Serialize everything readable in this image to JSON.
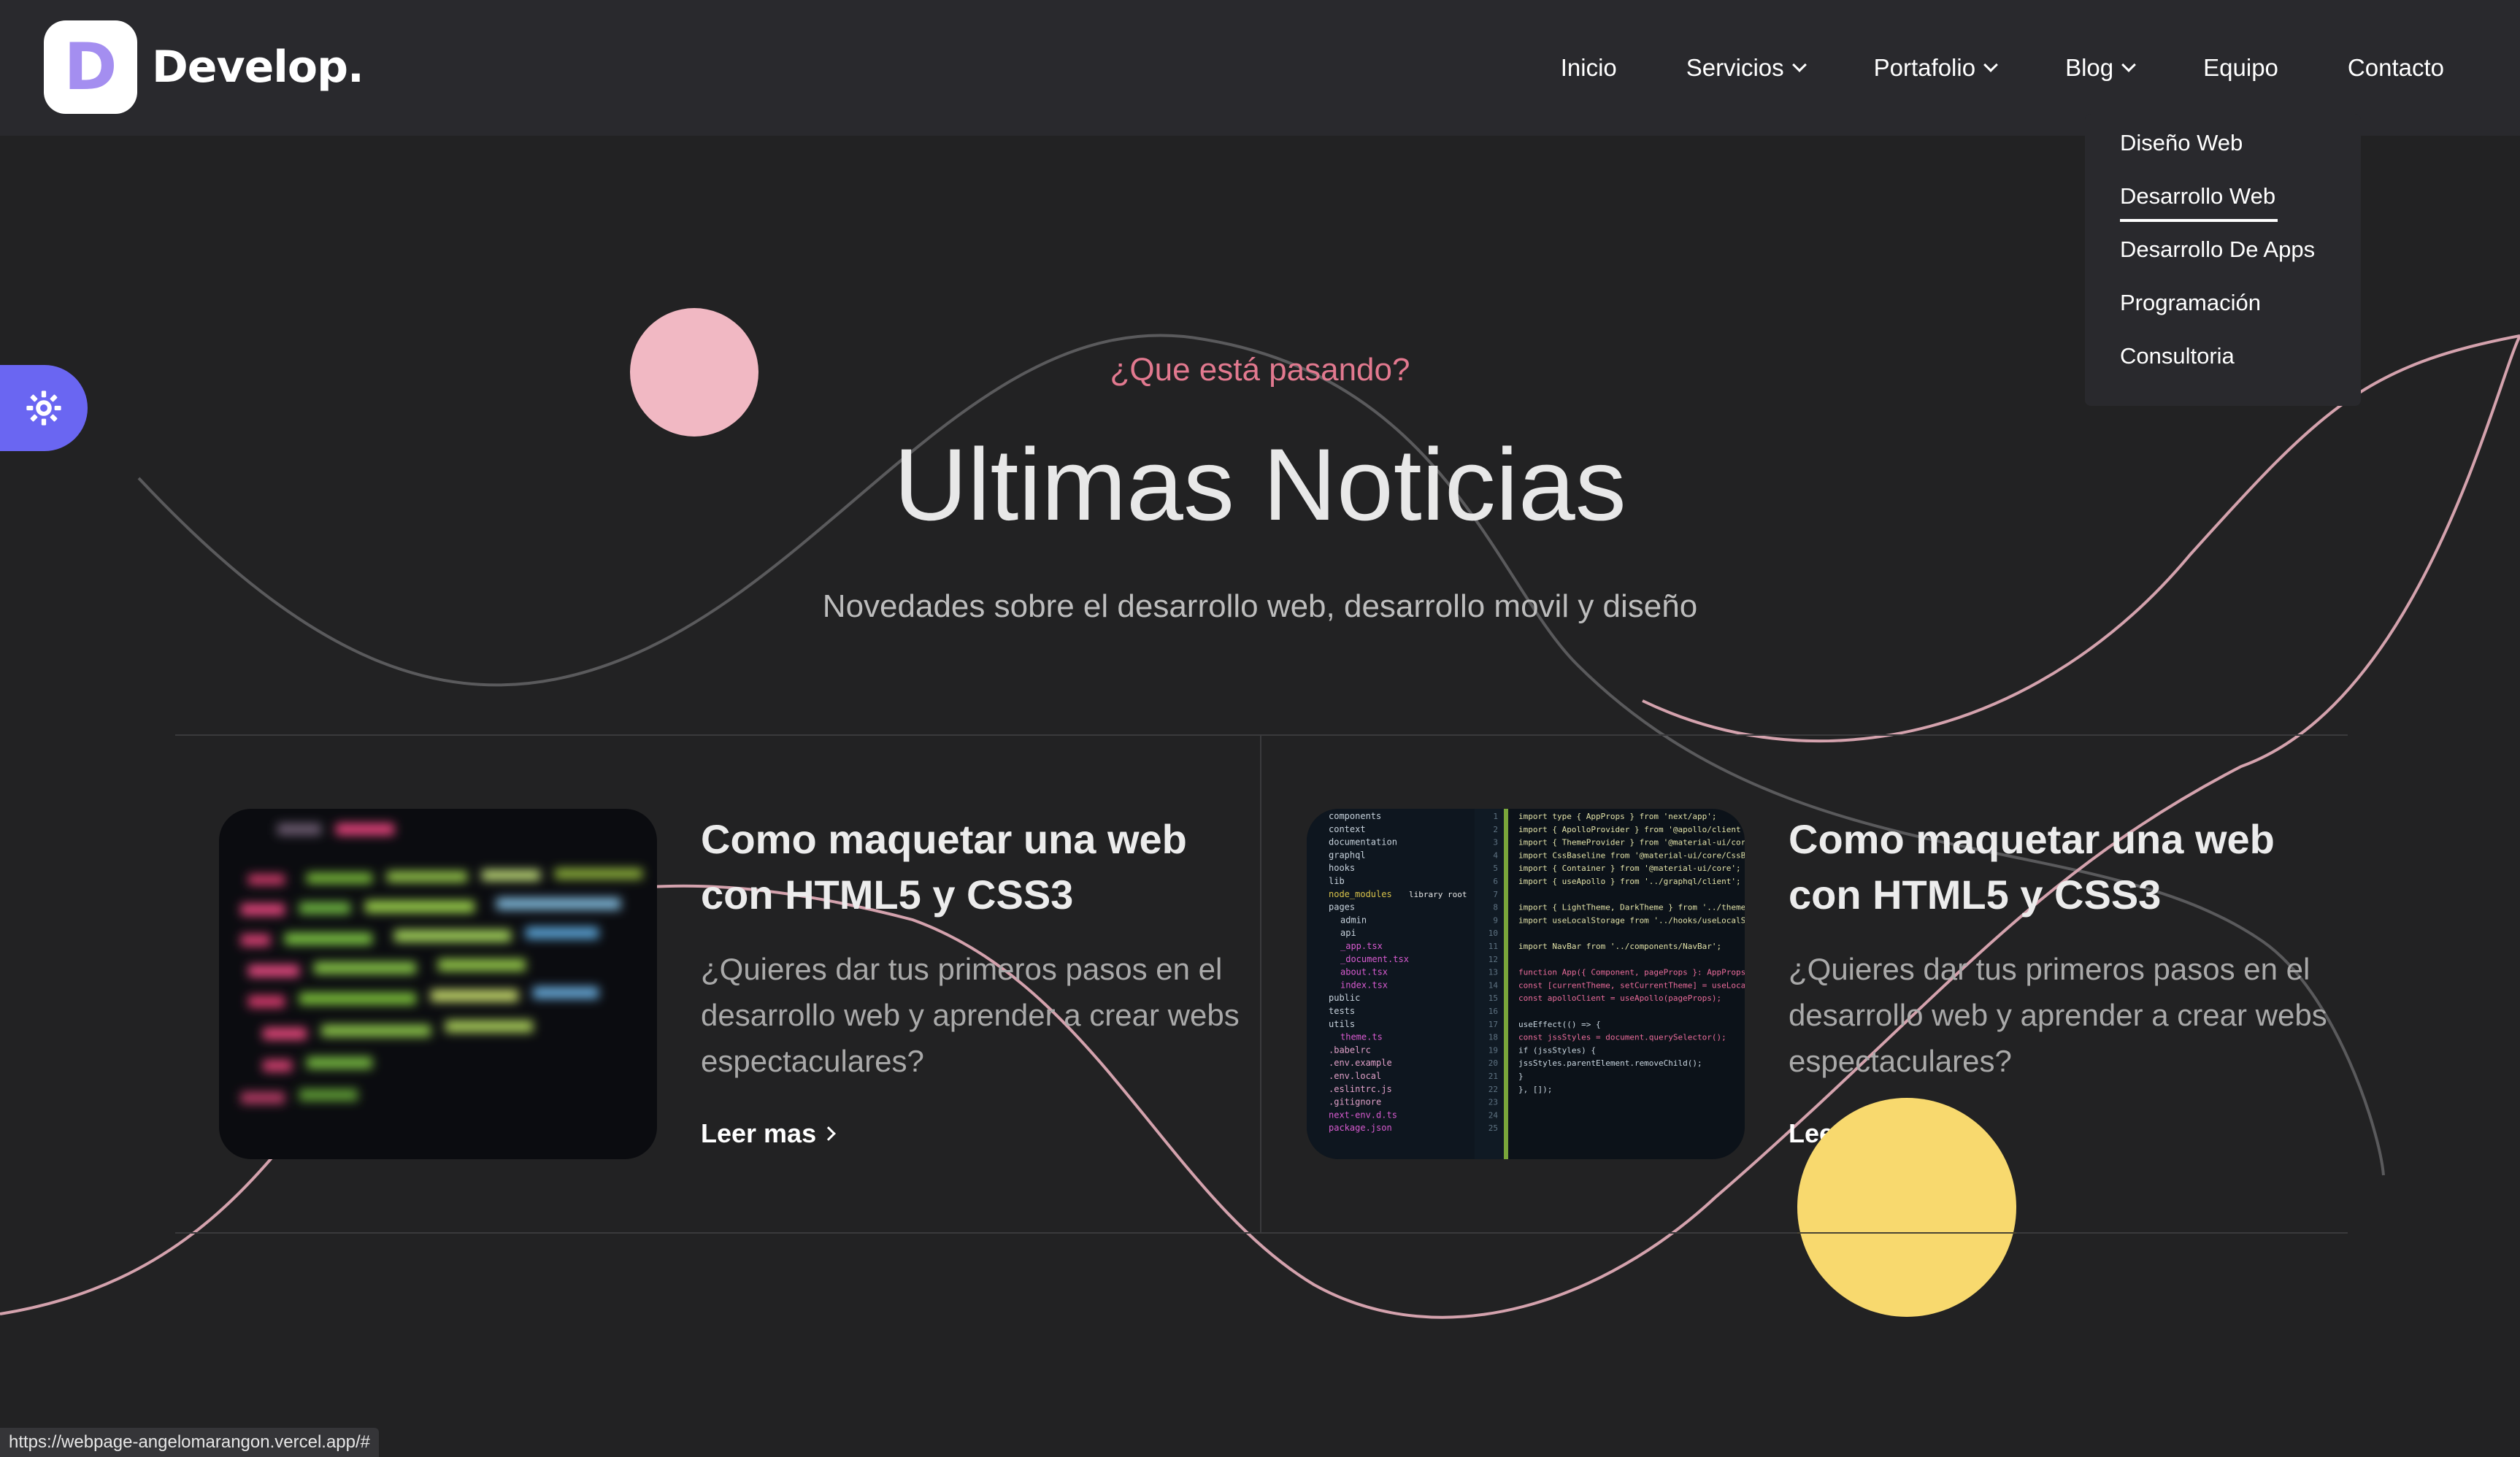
{
  "brand": {
    "letter": "D",
    "name": "Develop."
  },
  "nav": {
    "items": [
      {
        "label": "Inicio",
        "has_dropdown": false
      },
      {
        "label": "Servicios",
        "has_dropdown": true
      },
      {
        "label": "Portafolio",
        "has_dropdown": true
      },
      {
        "label": "Blog",
        "has_dropdown": true
      },
      {
        "label": "Equipo",
        "has_dropdown": false
      },
      {
        "label": "Contacto",
        "has_dropdown": false
      }
    ]
  },
  "dropdown": {
    "items": [
      {
        "label": "Diseño Web"
      },
      {
        "label": "Desarrollo Web",
        "active": true
      },
      {
        "label": "Desarrollo De Apps"
      },
      {
        "label": "Programación"
      },
      {
        "label": "Consultoria"
      }
    ]
  },
  "settings": {
    "icon": "gear-icon"
  },
  "hero": {
    "eyebrow": "¿Que está pasando?",
    "title": "Ultimas Noticias",
    "subtitle": "Novedades sobre el desarrollo web, desarrollo movil y diseño"
  },
  "posts": [
    {
      "title": "Como maquetar una web con HTML5 y CSS3",
      "excerpt": "¿Quieres dar tus primeros pasos en el desarrollo web y aprender a crear webs espectaculares?",
      "link_label": "Leer mas"
    },
    {
      "title": "Como maquetar una web con HTML5 y CSS3",
      "excerpt": "¿Quieres dar tus primeros pasos en el desarrollo web y aprender a crear webs espectaculares?",
      "link_label": "Leer mas"
    }
  ],
  "code_image": {
    "tree": [
      "components",
      "context",
      "documentation",
      "graphql",
      "hooks",
      "lib",
      "node_modules",
      "pages",
      "admin",
      "api",
      "_app.tsx",
      "_document.tsx",
      "about.tsx",
      "index.tsx",
      "public",
      "tests",
      "utils",
      "theme.ts",
      ".babelrc",
      ".env.example",
      ".env.local",
      ".eslintrc.js",
      ".gitignore",
      "next-env.d.ts",
      "package.json"
    ],
    "tree_badge": "library root",
    "code": [
      "import type { AppProps } from 'next/app';",
      "import { ApolloProvider } from '@apollo/client';",
      "import { ThemeProvider } from '@material-ui/core';",
      "import CssBaseline from '@material-ui/core/CssBaseline';",
      "import { Container } from '@material-ui/core';",
      "import { useApollo } from '../graphql/client';",
      "",
      "import { LightTheme, DarkTheme } from '../theme';",
      "import useLocalStorage from '../hooks/useLocalStorage';",
      "",
      "import NavBar from '../components/NavBar';",
      "",
      "function App({ Component, pageProps }: AppProps) {",
      "  const [currentTheme, setCurrentTheme] = useLocalStorage();",
      "  const apolloClient = useApollo(pageProps);",
      "",
      "  useEffect(() => {",
      "    const jssStyles = document.querySelector();",
      "    if (jssStyles) {",
      "      jssStyles.parentElement.removeChild();",
      "    }",
      "  }, []);"
    ],
    "line_numbers": [
      "1",
      "2",
      "3",
      "4",
      "5",
      "6",
      "7",
      "8",
      "9",
      "10",
      "11",
      "12",
      "13",
      "14",
      "15",
      "16",
      "17",
      "18",
      "19",
      "20",
      "21",
      "22",
      "23",
      "24",
      "25"
    ]
  },
  "status_bar": {
    "url": "https://webpage-angelomarangon.vercel.app/#"
  },
  "colors": {
    "accent": "#6a66f2",
    "logo_letter": "#a48ef0",
    "eyebrow": "#e2798f",
    "circle_pink": "#f1b8c3",
    "circle_yellow": "#f8d96e",
    "wave": "#d4a2ad"
  }
}
